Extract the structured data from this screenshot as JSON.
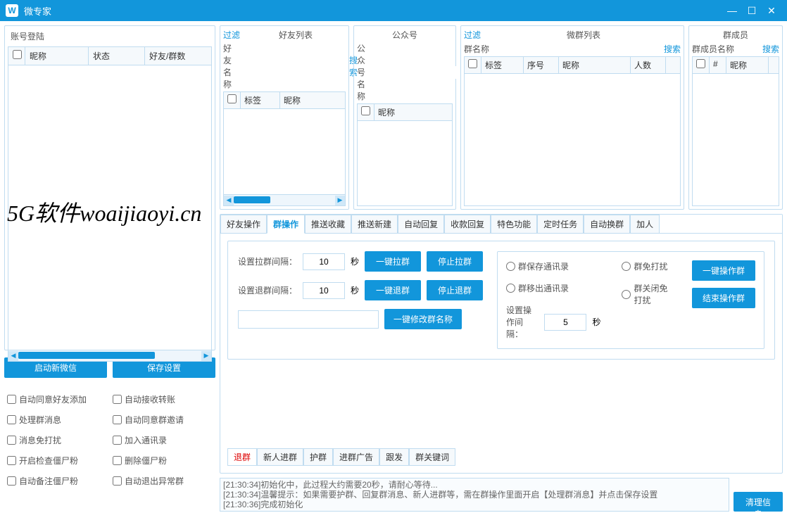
{
  "titlebar": {
    "title": "微专家"
  },
  "watermark": "5G软件woaijiaoyi.cn",
  "account": {
    "title": "账号登陆",
    "cols": {
      "nick": "昵称",
      "status": "状态",
      "count": "好友/群数"
    }
  },
  "buttons": {
    "start_wechat": "启动新微信",
    "save_settings": "保存设置"
  },
  "checkboxes": {
    "auto_accept_friend": "自动同意好友添加",
    "auto_receive_transfer": "自动接收转账",
    "process_group_msg": "处理群消息",
    "auto_accept_group": "自动同意群邀请",
    "msg_no_disturb": "消息免打扰",
    "add_contacts": "加入通讯录",
    "check_zombie": "开启检查僵尸粉",
    "delete_zombie": "删除僵尸粉",
    "auto_remark_zombie": "自动备注僵尸粉",
    "auto_quit_abnormal": "自动退出异常群"
  },
  "lists": {
    "filter": "过滤",
    "search": "搜索",
    "friends": {
      "title": "好友列表",
      "search_label": "好友名称",
      "col_tag": "标签",
      "col_nick": "昵称"
    },
    "gzh": {
      "title": "公众号",
      "search_label": "公众号名称",
      "col_nick": "昵称"
    },
    "groups": {
      "title": "微群列表",
      "search_label": "群名称",
      "col_tag": "标签",
      "col_seq": "序号",
      "col_nick": "昵称",
      "col_count": "人数"
    },
    "members": {
      "title": "群成员",
      "search_label": "群成员名称",
      "col_num": "#",
      "col_nick": "昵称"
    }
  },
  "tabs": [
    "好友操作",
    "群操作",
    "推送收藏",
    "推送新建",
    "自动回复",
    "收款回复",
    "特色功能",
    "定时任务",
    "自动换群",
    "加人"
  ],
  "active_tab": 1,
  "group_op": {
    "pull_interval_label": "设置拉群间隔：",
    "pull_interval": "10",
    "quit_interval_label": "设置退群间隔：",
    "quit_interval": "10",
    "second": "秒",
    "btn_pull": "一键拉群",
    "btn_stop_pull": "停止拉群",
    "btn_quit": "一键退群",
    "btn_stop_quit": "停止退群",
    "btn_rename": "一键修改群名称",
    "radio_save_contacts": "群保存通讯录",
    "radio_no_disturb": "群免打扰",
    "radio_remove_contacts": "群移出通讯录",
    "radio_close_disturb": "群关闭免打扰",
    "op_interval_label": "设置操作间隔：",
    "op_interval": "5",
    "btn_op_group": "一键操作群",
    "btn_end_op": "结束操作群"
  },
  "sub_tabs": [
    "退群",
    "新人进群",
    "护群",
    "进群广告",
    "跟发",
    "群关键词"
  ],
  "active_sub_tab": 0,
  "log": {
    "line1": "[21:30:34]初始化中，此过程大约需要20秒，请耐心等待...",
    "line2": "[21:30:34]温馨提示：如果需要护群、回复群消息、新人进群等，需在群操作里面开启【处理群消息】并点击保存设置",
    "line3": "[21:30:36]完成初始化"
  },
  "clear_log": "清理信息"
}
